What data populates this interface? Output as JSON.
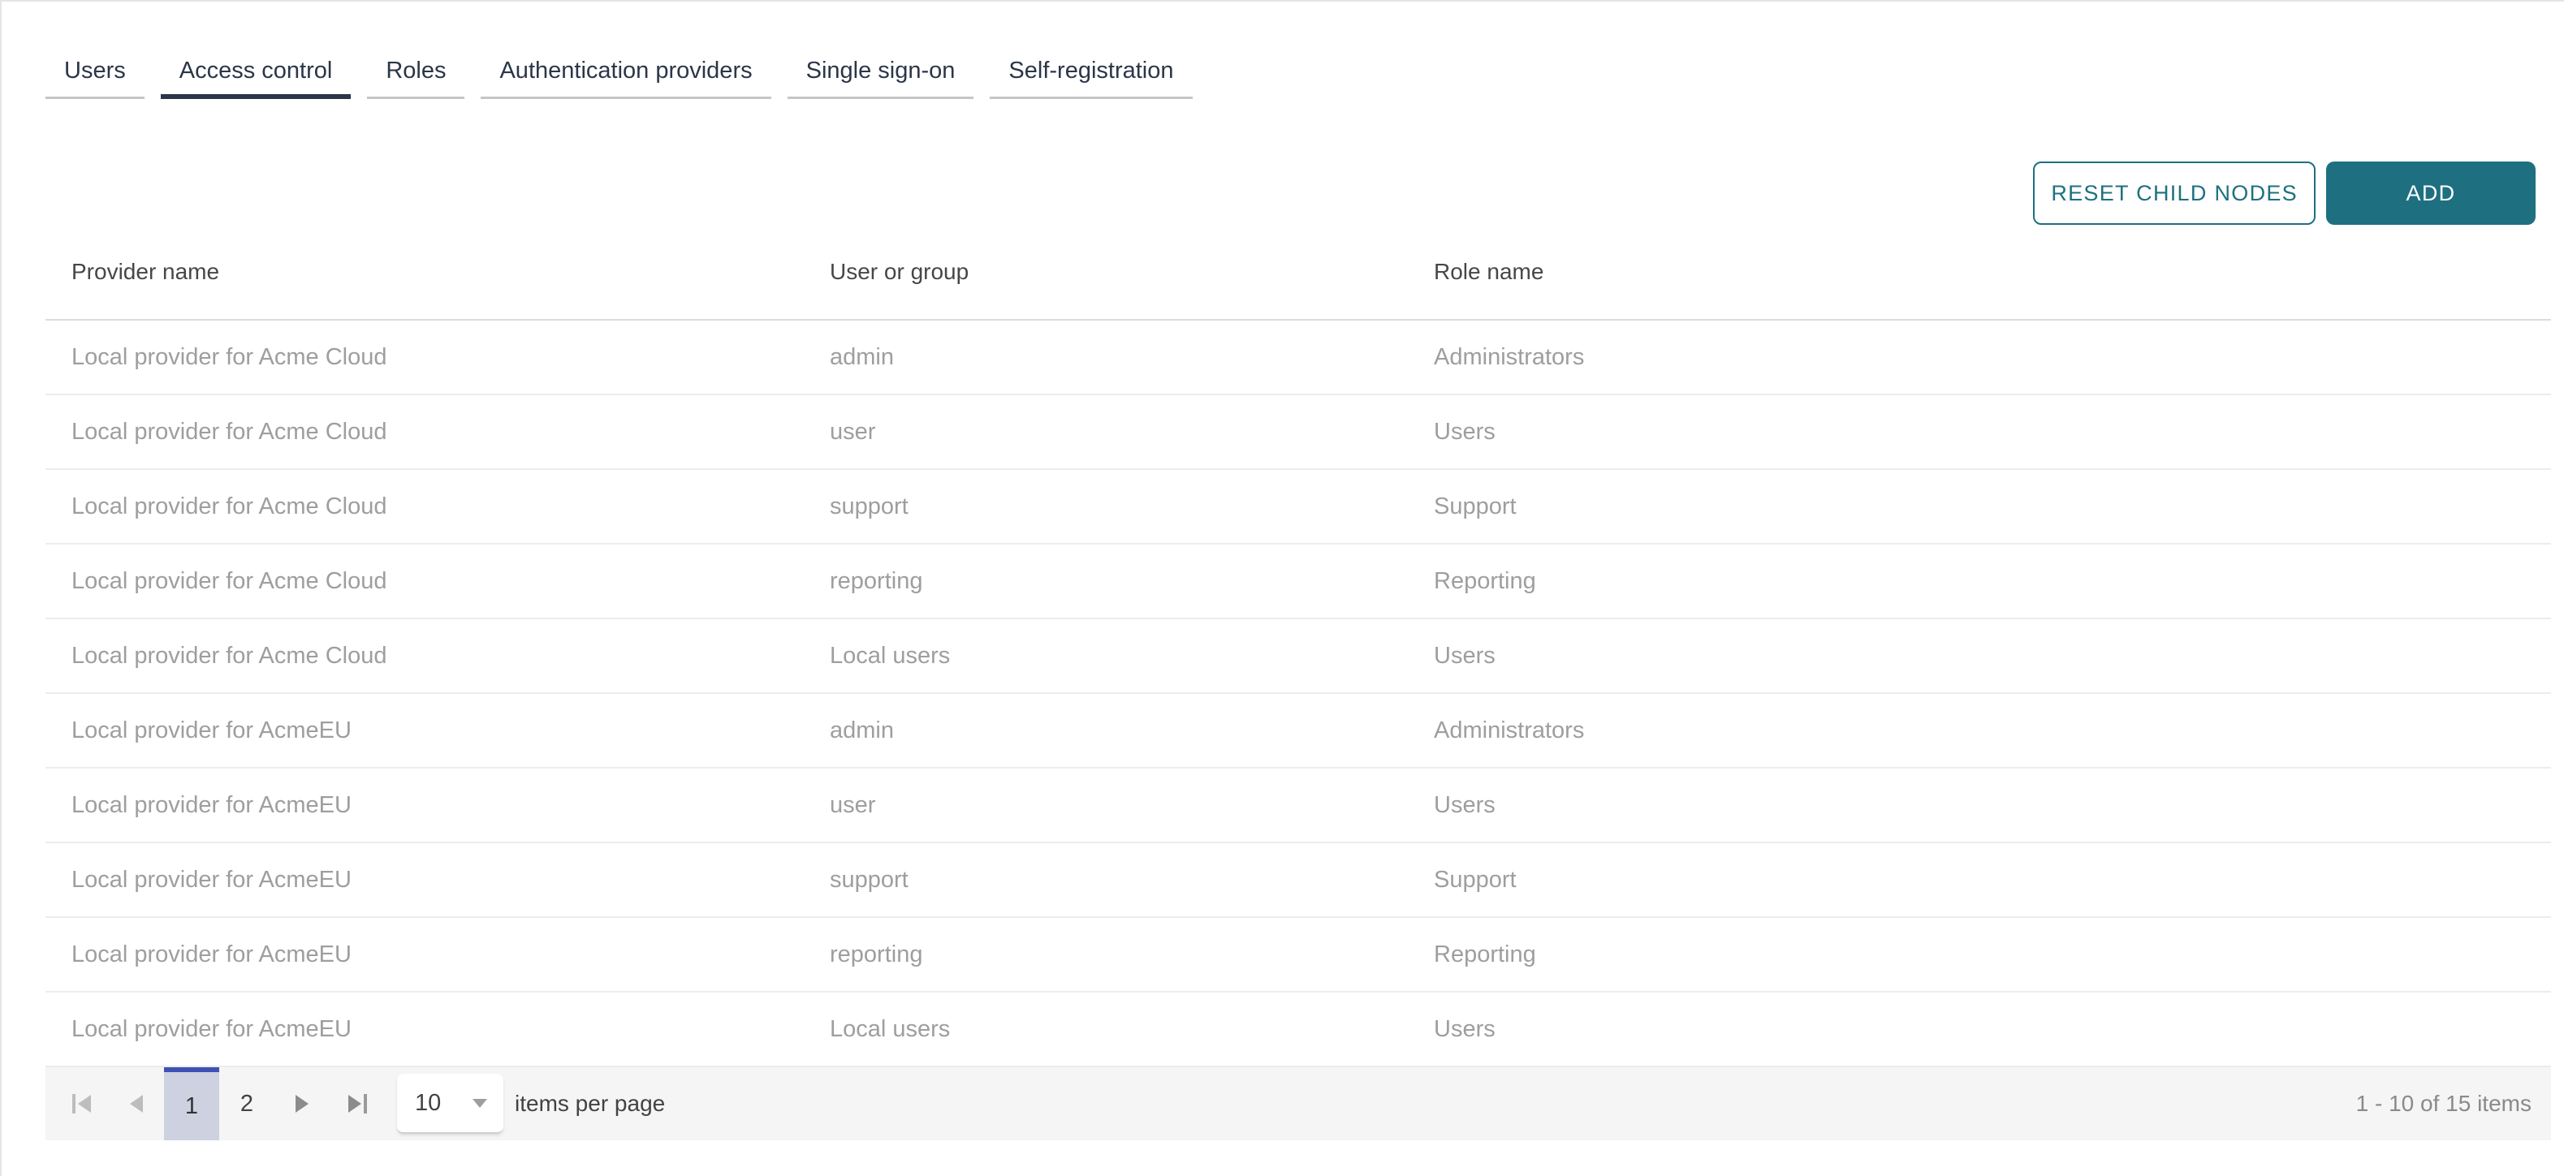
{
  "tabs": [
    {
      "label": "Users",
      "active": false
    },
    {
      "label": "Access control",
      "active": true
    },
    {
      "label": "Roles",
      "active": false
    },
    {
      "label": "Authentication providers",
      "active": false
    },
    {
      "label": "Single sign-on",
      "active": false
    },
    {
      "label": "Self-registration",
      "active": false
    }
  ],
  "toolbar": {
    "reset_label": "RESET CHILD NODES",
    "add_label": "ADD"
  },
  "table": {
    "columns": [
      "Provider name",
      "User or group",
      "Role name"
    ],
    "rows": [
      [
        "Local provider for Acme Cloud",
        "admin",
        "Administrators"
      ],
      [
        "Local provider for Acme Cloud",
        "user",
        "Users"
      ],
      [
        "Local provider for Acme Cloud",
        "support",
        "Support"
      ],
      [
        "Local provider for Acme Cloud",
        "reporting",
        "Reporting"
      ],
      [
        "Local provider for Acme Cloud",
        "Local users",
        "Users"
      ],
      [
        "Local provider for AcmeEU",
        "admin",
        "Administrators"
      ],
      [
        "Local provider for AcmeEU",
        "user",
        "Users"
      ],
      [
        "Local provider for AcmeEU",
        "support",
        "Support"
      ],
      [
        "Local provider for AcmeEU",
        "reporting",
        "Reporting"
      ],
      [
        "Local provider for AcmeEU",
        "Local users",
        "Users"
      ]
    ]
  },
  "pager": {
    "pages": [
      "1",
      "2"
    ],
    "current_page": "1",
    "page_size": "10",
    "items_per_page_label": "items per page",
    "info": "1 - 10 of 15 items"
  },
  "colors": {
    "accent_teal": "#1e7080",
    "tab_text": "#2b3648",
    "active_tab_underline": "#2b3648",
    "inactive_tab_underline": "#c6c6c6",
    "selected_page_bg": "#cdd1e0",
    "selected_page_top_border": "#3f51b5",
    "header_text": "#474747",
    "row_text": "#9e9e9e",
    "pager_bg": "#f5f5f5",
    "panel_border": "#e4e4e4"
  }
}
